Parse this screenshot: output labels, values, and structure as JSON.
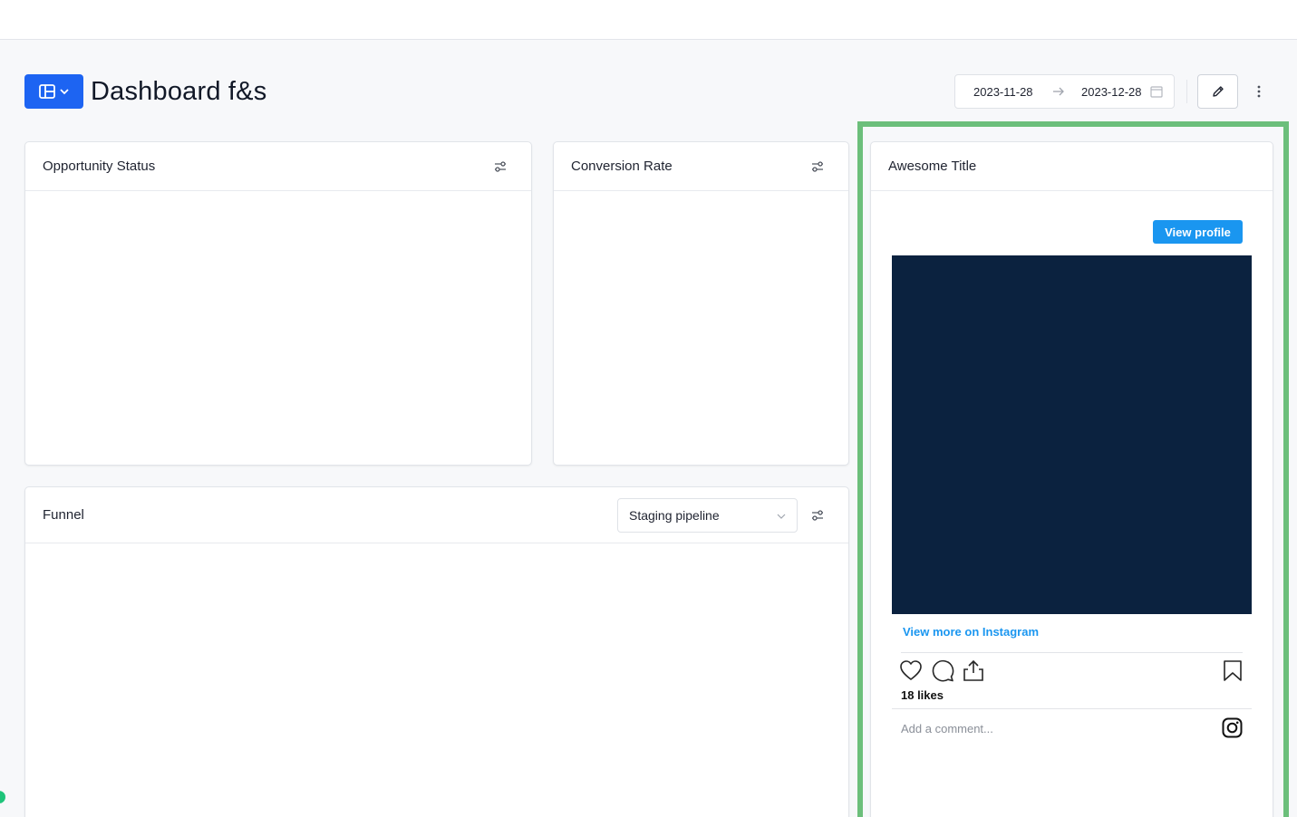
{
  "page": {
    "title": "Dashboard f&s"
  },
  "date_range": {
    "start": "2023-11-28",
    "end": "2023-12-28"
  },
  "widgets": {
    "opportunity_status": {
      "title": "Opportunity Status"
    },
    "conversion_rate": {
      "title": "Conversion Rate"
    },
    "funnel": {
      "title": "Funnel",
      "pipeline_select": "Staging pipeline"
    },
    "instagram": {
      "title": "Awesome Title",
      "view_profile": "View profile",
      "view_more": "View more on Instagram",
      "likes": "18 likes",
      "comment_placeholder": "Add a comment..."
    }
  },
  "colors": {
    "accent": "#1d64f2",
    "instagram_blue": "#1a96f0",
    "highlight": "#6cbf7b",
    "image_bg": "#0b223f"
  },
  "icons": {
    "layout": "layout-icon",
    "edit": "pencil-icon",
    "more": "vertical-dots-icon",
    "filter": "sliders-icon",
    "heart": "heart-icon",
    "comment": "comment-icon",
    "share": "share-icon",
    "bookmark": "bookmark-icon",
    "instagram": "instagram-icon"
  }
}
